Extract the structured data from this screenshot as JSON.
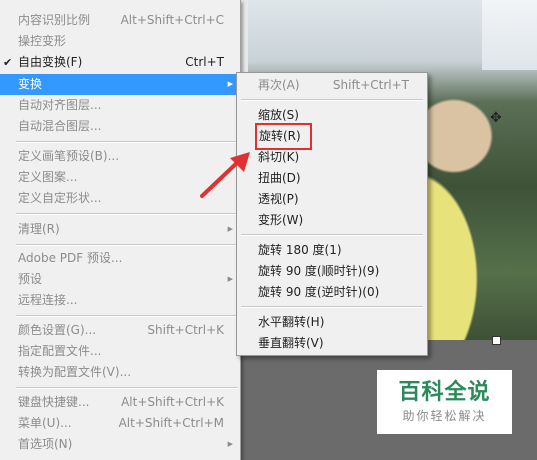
{
  "main_menu": {
    "items": [
      {
        "label": "内容识别比例",
        "shortcut": "Alt+Shift+Ctrl+C"
      },
      {
        "label": "操控变形",
        "shortcut": ""
      },
      {
        "label": "自由变换(F)",
        "shortcut": "Ctrl+T",
        "check": "✔"
      },
      {
        "label": "变换",
        "shortcut": "",
        "arrow": "▶"
      },
      {
        "label": "自动对齐图层...",
        "shortcut": ""
      },
      {
        "label": "自动混合图层...",
        "shortcut": ""
      },
      {
        "label": "定义画笔预设(B)...",
        "shortcut": ""
      },
      {
        "label": "定义图案...",
        "shortcut": ""
      },
      {
        "label": "定义自定形状...",
        "shortcut": ""
      },
      {
        "label": "清理(R)",
        "shortcut": "",
        "arrow": "▶"
      },
      {
        "label": "Adobe PDF 预设...",
        "shortcut": ""
      },
      {
        "label": "预设",
        "shortcut": "",
        "arrow": "▶"
      },
      {
        "label": "远程连接...",
        "shortcut": ""
      },
      {
        "label": "颜色设置(G)...",
        "shortcut": "Shift+Ctrl+K"
      },
      {
        "label": "指定配置文件...",
        "shortcut": ""
      },
      {
        "label": "转换为配置文件(V)...",
        "shortcut": ""
      },
      {
        "label": "键盘快捷键...",
        "shortcut": "Alt+Shift+Ctrl+K"
      },
      {
        "label": "菜单(U)...",
        "shortcut": "Alt+Shift+Ctrl+M"
      },
      {
        "label": "首选项(N)",
        "shortcut": "",
        "arrow": "▶"
      }
    ]
  },
  "transform_submenu": {
    "items": [
      {
        "label": "再次(A)",
        "shortcut": "Shift+Ctrl+T"
      },
      {
        "label": "缩放(S)",
        "shortcut": ""
      },
      {
        "label": "旋转(R)",
        "shortcut": ""
      },
      {
        "label": "斜切(K)",
        "shortcut": ""
      },
      {
        "label": "扭曲(D)",
        "shortcut": ""
      },
      {
        "label": "透视(P)",
        "shortcut": ""
      },
      {
        "label": "变形(W)",
        "shortcut": ""
      },
      {
        "label": "旋转 180 度(1)",
        "shortcut": ""
      },
      {
        "label": "旋转 90 度(顺时针)(9)",
        "shortcut": ""
      },
      {
        "label": "旋转 90 度(逆时针)(0)",
        "shortcut": ""
      },
      {
        "label": "水平翻转(H)",
        "shortcut": ""
      },
      {
        "label": "垂直翻转(V)",
        "shortcut": ""
      }
    ]
  },
  "watermark": {
    "title": "百科全说",
    "subtitle": "助你轻松解决"
  },
  "icons": {
    "move_cursor": "✥"
  },
  "colors": {
    "highlight": "#3399ff",
    "annotation": "#e03030",
    "watermark_green": "#2c8a5a"
  }
}
